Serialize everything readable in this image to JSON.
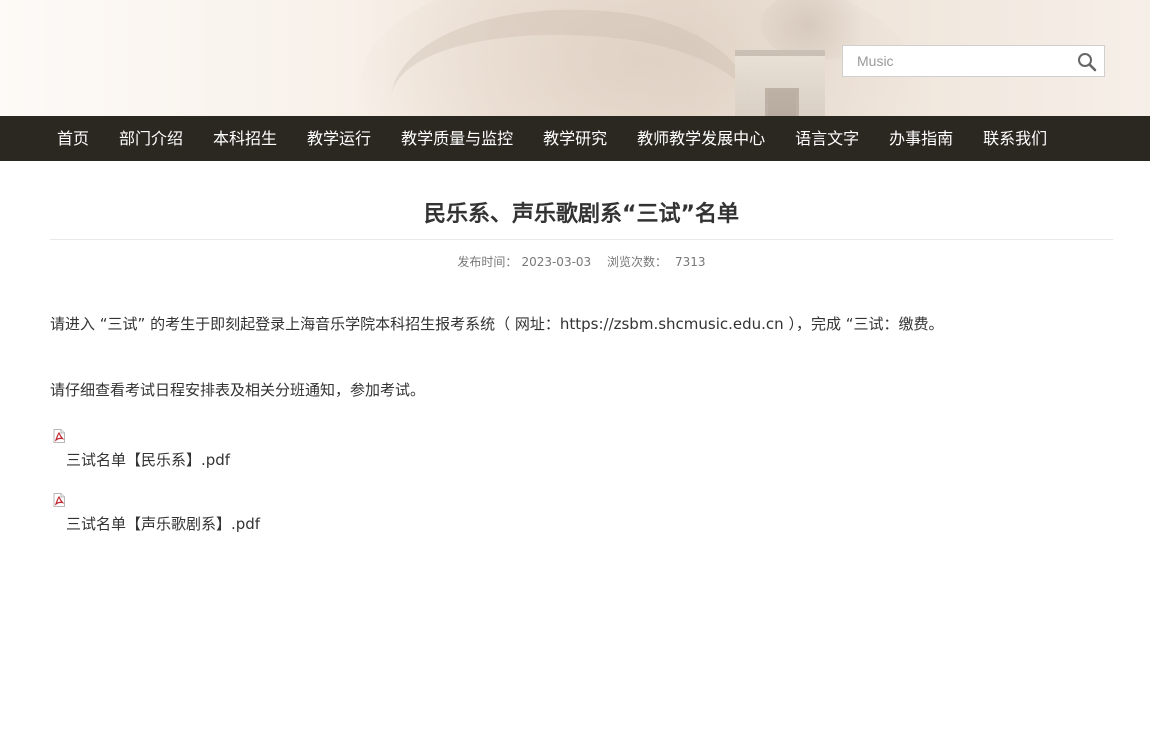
{
  "header": {
    "search": {
      "value": "",
      "placeholder": "Music",
      "icon": "search-icon"
    }
  },
  "nav": {
    "items": [
      {
        "label": "首页"
      },
      {
        "label": "部门介绍"
      },
      {
        "label": "本科招生"
      },
      {
        "label": "教学运行"
      },
      {
        "label": "教学质量与监控"
      },
      {
        "label": "教学研究"
      },
      {
        "label": "教师教学发展中心"
      },
      {
        "label": "语言文字"
      },
      {
        "label": "办事指南"
      },
      {
        "label": "联系我们"
      }
    ]
  },
  "article": {
    "title": "民乐系、声乐歌剧系“三试”名单",
    "meta": {
      "publish_label": "发布时间：",
      "publish_date": "2023-03-03",
      "views_label": "浏览次数：",
      "views_count": "7313"
    },
    "paragraphs": [
      "请进入 “三试” 的考生于即刻起登录上海音乐学院本科招生报考系统（ 网址：https://zsbm.shcmusic.edu.cn ），完成 “三试：缴费。",
      "请仔细查看考试日程安排表及相关分班通知，参加考试。"
    ],
    "attachments": [
      {
        "name": "三试名单【民乐系】.pdf",
        "icon": "pdf-icon"
      },
      {
        "name": "三试名单【声乐歌剧系】.pdf",
        "icon": "pdf-icon"
      }
    ]
  },
  "colors": {
    "nav_bg": "#2b2822",
    "nav_text": "#ffffff",
    "text": "#333333",
    "meta_text": "#777777",
    "banner_bg": "#f3ebe3"
  }
}
